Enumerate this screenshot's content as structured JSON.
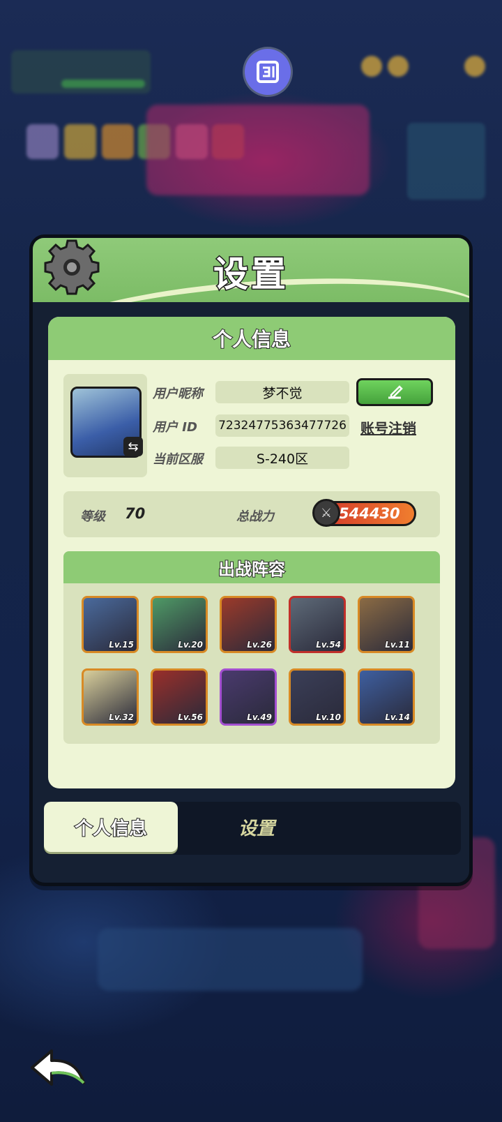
{
  "panel": {
    "title": "设置"
  },
  "profile": {
    "section_title": "个人信息",
    "nickname_label": "用户昵称",
    "nickname_value": "梦不觉",
    "id_label": "用户 ID",
    "id_value": "72324775363477726",
    "server_label": "当前区服",
    "server_value": "S-240区",
    "cancel_account_label": "账号注销",
    "level_label": "等级",
    "level_value": "70",
    "power_label": "总战力",
    "power_value": "544430"
  },
  "lineup": {
    "title": "出战阵容",
    "heroes": [
      {
        "level": "Lv.15",
        "color": "#4a6a9c",
        "border": "#d88a25"
      },
      {
        "level": "Lv.20",
        "color": "#4f9a66",
        "border": "#d88a25"
      },
      {
        "level": "Lv.26",
        "color": "#9c3a2a",
        "border": "#d88a25"
      },
      {
        "level": "Lv.54",
        "color": "#5e6a78",
        "border": "#c0302a"
      },
      {
        "level": "Lv.11",
        "color": "#8b6b44",
        "border": "#d88a25"
      },
      {
        "level": "Lv.32",
        "color": "#d9cf9b",
        "border": "#d88a25"
      },
      {
        "level": "Lv.56",
        "color": "#9a2f2a",
        "border": "#d88a25"
      },
      {
        "level": "Lv.49",
        "color": "#4a3a6e",
        "border": "#a34fd0"
      },
      {
        "level": "Lv.10",
        "color": "#3b3f58",
        "border": "#d88a25"
      },
      {
        "level": "Lv.14",
        "color": "#3e5fa0",
        "border": "#d88a25"
      }
    ]
  },
  "tabs": {
    "personal_info": "个人信息",
    "settings": "设置"
  },
  "colors": {
    "header_green": "#8fca79",
    "panel_dark": "#152033",
    "card_bg": "#eef5d6"
  }
}
